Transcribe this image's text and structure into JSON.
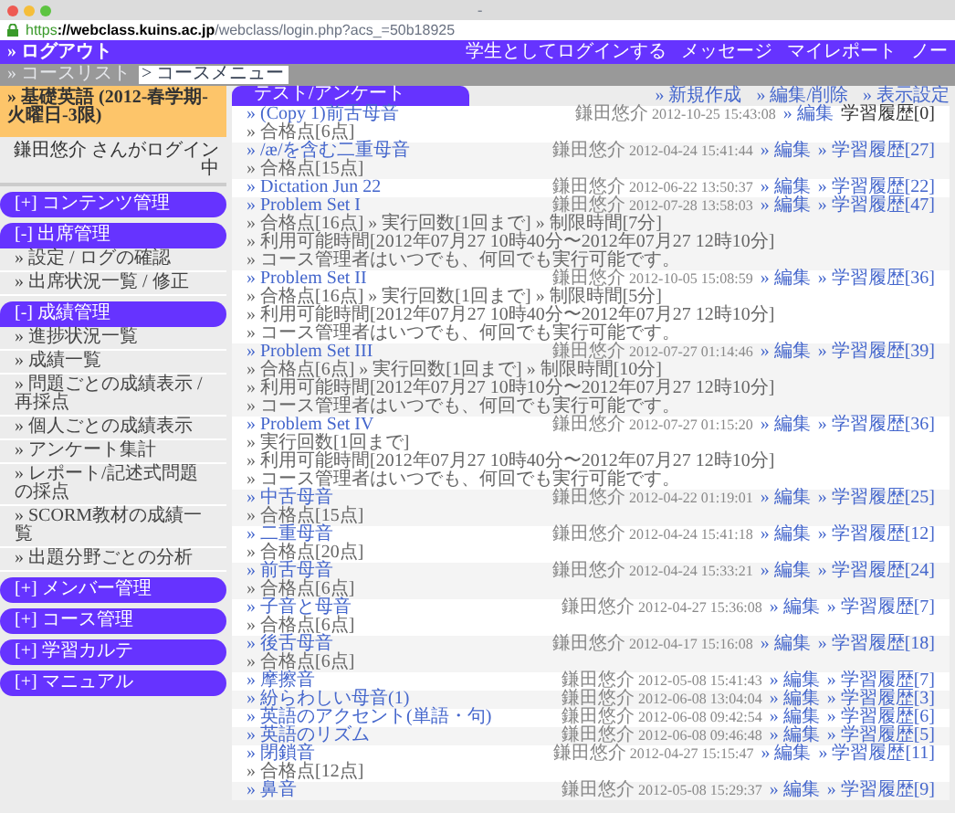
{
  "window": {
    "title": "-",
    "url_scheme": "https",
    "url_host": "://webclass.kuins.ac.jp",
    "url_path": "/webclass/login.php?acs_=50b18925"
  },
  "top_bar": {
    "logout": "» ログアウト",
    "links": [
      "学生としてログインする",
      "メッセージ",
      "マイレポート",
      "ノー"
    ]
  },
  "breadcrumb": [
    {
      "label": "» コースリスト",
      "selected": false
    },
    {
      "label": "> コースメニュー",
      "selected": true
    }
  ],
  "sidebar": {
    "course": "» 基礎英語 (2012-春学期-火曜日-3限)",
    "login_status": "鎌田悠介 さんがログイン中",
    "sections": [
      {
        "label": "[+] コンテンツ管理",
        "expanded": false
      },
      {
        "label": "[-] 出席管理",
        "expanded": true,
        "items": [
          "» 設定 / ログの確認",
          "» 出席状況一覧 / 修正"
        ]
      },
      {
        "label": "[-] 成績管理",
        "expanded": true,
        "items": [
          "» 進捗状況一覧",
          "» 成績一覧",
          "» 問題ごとの成績表示 / 再採点",
          "» 個人ごとの成績表示",
          "» アンケート集計",
          "» レポート/記述式問題の採点",
          "» SCORM教材の成績一覧",
          "» 出題分野ごとの分析"
        ]
      },
      {
        "label": "[+] メンバー管理",
        "expanded": false
      },
      {
        "label": "[+] コース管理",
        "expanded": false
      },
      {
        "label": "[+] 学習カルテ",
        "expanded": false
      },
      {
        "label": "[+] マニュアル",
        "expanded": false
      }
    ]
  },
  "main": {
    "tab": "テスト/アンケート",
    "actions": [
      "» 新規作成",
      "» 編集/削除",
      "» 表示設定"
    ],
    "rows": [
      {
        "title": "» (Copy 1)前舌母音",
        "author": "鎌田悠介",
        "date": "2012-10-25 15:43:08",
        "edit": "» 編集",
        "history": "学習履歴[0]",
        "history_link": false,
        "details": [
          "» 合格点[6点]"
        ]
      },
      {
        "title": "» /æ/を含む二重母音",
        "author": "鎌田悠介",
        "date": "2012-04-24 15:41:44",
        "edit": "» 編集",
        "history": "» 学習履歴[27]",
        "history_link": true,
        "details": [
          "» 合格点[15点]"
        ]
      },
      {
        "title": "» Dictation Jun 22",
        "author": "鎌田悠介",
        "date": "2012-06-22 13:50:37",
        "edit": "» 編集",
        "history": "» 学習履歴[22]",
        "history_link": true
      },
      {
        "title": "» Problem Set I",
        "author": "鎌田悠介",
        "date": "2012-07-28 13:58:03",
        "edit": "» 編集",
        "history": "» 学習履歴[47]",
        "history_link": true,
        "details": [
          "» 合格点[16点] » 実行回数[1回まで] » 制限時間[7分]",
          "» 利用可能時間[2012年07月27 10時40分〜2012年07月27 12時10分]",
          "» コース管理者はいつでも、何回でも実行可能です。"
        ]
      },
      {
        "title": "» Problem Set II",
        "author": "鎌田悠介",
        "date": "2012-10-05 15:08:59",
        "edit": "» 編集",
        "history": "» 学習履歴[36]",
        "history_link": true,
        "details": [
          "» 合格点[16点] » 実行回数[1回まで] » 制限時間[5分]",
          "» 利用可能時間[2012年07月27 10時40分〜2012年07月27 12時10分]",
          "» コース管理者はいつでも、何回でも実行可能です。"
        ]
      },
      {
        "title": "» Problem Set III",
        "author": "鎌田悠介",
        "date": "2012-07-27 01:14:46",
        "edit": "» 編集",
        "history": "» 学習履歴[39]",
        "history_link": true,
        "details": [
          "» 合格点[6点] » 実行回数[1回まで] » 制限時間[10分]",
          "» 利用可能時間[2012年07月27 10時10分〜2012年07月27 12時10分]",
          "» コース管理者はいつでも、何回でも実行可能です。"
        ]
      },
      {
        "title": "» Problem Set IV",
        "author": "鎌田悠介",
        "date": "2012-07-27 01:15:20",
        "edit": "» 編集",
        "history": "» 学習履歴[36]",
        "history_link": true,
        "details": [
          "» 実行回数[1回まで]",
          "» 利用可能時間[2012年07月27 10時40分〜2012年07月27 12時10分]",
          "» コース管理者はいつでも、何回でも実行可能です。"
        ]
      },
      {
        "title": "» 中舌母音",
        "author": "鎌田悠介",
        "date": "2012-04-22 01:19:01",
        "edit": "» 編集",
        "history": "» 学習履歴[25]",
        "history_link": true,
        "details": [
          "» 合格点[15点]"
        ]
      },
      {
        "title": "» 二重母音",
        "author": "鎌田悠介",
        "date": "2012-04-24 15:41:18",
        "edit": "» 編集",
        "history": "» 学習履歴[12]",
        "history_link": true,
        "details": [
          "» 合格点[20点]"
        ]
      },
      {
        "title": "» 前舌母音",
        "author": "鎌田悠介",
        "date": "2012-04-24 15:33:21",
        "edit": "» 編集",
        "history": "» 学習履歴[24]",
        "history_link": true,
        "details": [
          "» 合格点[6点]"
        ]
      },
      {
        "title": "» 子音と母音",
        "author": "鎌田悠介",
        "date": "2012-04-27 15:36:08",
        "edit": "» 編集",
        "history": "» 学習履歴[7]",
        "history_link": true,
        "details": [
          "» 合格点[6点]"
        ]
      },
      {
        "title": "» 後舌母音",
        "author": "鎌田悠介",
        "date": "2012-04-17 15:16:08",
        "edit": "» 編集",
        "history": "» 学習履歴[18]",
        "history_link": true,
        "details": [
          "» 合格点[6点]"
        ]
      },
      {
        "title": "» 摩擦音",
        "author": "鎌田悠介",
        "date": "2012-05-08 15:41:43",
        "edit": "» 編集",
        "history": "» 学習履歴[7]",
        "history_link": true
      },
      {
        "title": "» 紛らわしい母音(1)",
        "author": "鎌田悠介",
        "date": "2012-06-08 13:04:04",
        "edit": "» 編集",
        "history": "» 学習履歴[3]",
        "history_link": true
      },
      {
        "title": "» 英語のアクセント(単語・句)",
        "author": "鎌田悠介",
        "date": "2012-06-08 09:42:54",
        "edit": "» 編集",
        "history": "» 学習履歴[6]",
        "history_link": true
      },
      {
        "title": "» 英語のリズム",
        "author": "鎌田悠介",
        "date": "2012-06-08 09:46:48",
        "edit": "» 編集",
        "history": "» 学習履歴[5]",
        "history_link": true
      },
      {
        "title": "» 閉鎖音",
        "author": "鎌田悠介",
        "date": "2012-04-27 15:15:47",
        "edit": "» 編集",
        "history": "» 学習履歴[11]",
        "history_link": true,
        "details": [
          "» 合格点[12点]"
        ]
      },
      {
        "title": "» 鼻音",
        "author": "鎌田悠介",
        "date": "2012-05-08 15:29:37",
        "edit": "» 編集",
        "history": "» 学習履歴[9]",
        "history_link": true
      }
    ]
  }
}
